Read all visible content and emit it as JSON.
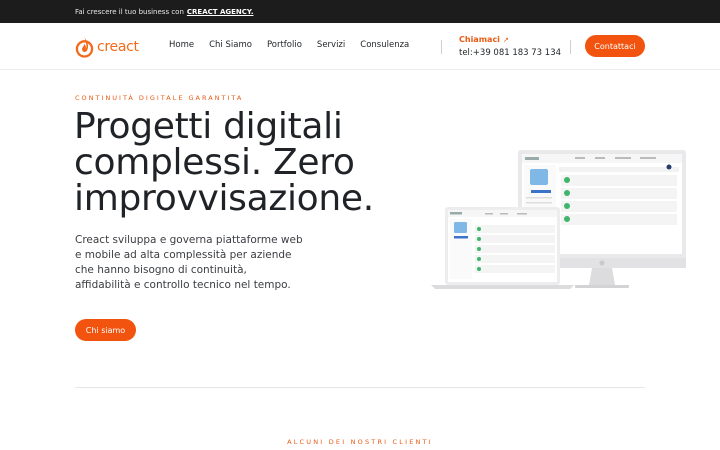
{
  "topbar": {
    "text": "Fai crescere il tuo business con",
    "link": "CREACT AGENCY."
  },
  "brand": {
    "name": "creact",
    "accent": "#f26a1b"
  },
  "nav": {
    "items": [
      "Home",
      "Chi Siamo",
      "Portfolio",
      "Servizi",
      "Consulenza"
    ],
    "call_label": "Chiamaci",
    "call_arrow": "↗",
    "phone": "tel:+39 081 183 73 134",
    "cta": "Contattaci"
  },
  "hero": {
    "eyebrow": "CONTINUITÀ DIGITALE GARANTITA",
    "title_1": "Progetti digitali",
    "title_2": "complessi. Zero",
    "title_3": "improvvisazione.",
    "lead": "Creact sviluppa e governa piattaforme web e mobile ad alta complessità per aziende che hanno bisogno di continuità, affidabilità e controllo tecnico nel tempo.",
    "button": "Chi siamo"
  },
  "clients": {
    "heading": "ALCUNI DEI NOSTRI CLIENTI"
  },
  "colors": {
    "orange": "#f2530e",
    "dark": "#1c1c1c"
  }
}
